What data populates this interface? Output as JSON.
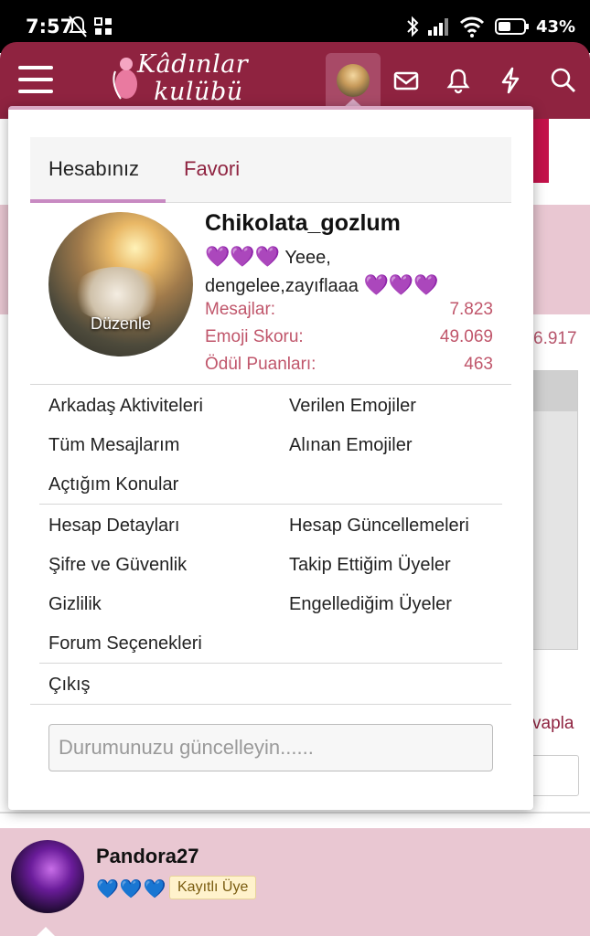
{
  "statusbar": {
    "time": "7:57",
    "battery": "43%"
  },
  "popup": {
    "tabs": [
      {
        "label": "Hesabınız"
      },
      {
        "label": "Favori"
      }
    ],
    "profile": {
      "edit_label": "Düzenle",
      "username": "Chikolata_gozlum",
      "status_hearts": "💜💜💜",
      "status_text": "Yeee, dengelee,zayıflaaa",
      "status_hearts_end": "💜💜💜"
    },
    "stats": [
      {
        "label": "Mesajlar:",
        "value": "7.823"
      },
      {
        "label": "Emoji Skoru:",
        "value": "49.069"
      },
      {
        "label": "Ödül Puanları:",
        "value": "463"
      }
    ],
    "links_group1": {
      "left": [
        "Arkadaş Aktiviteleri",
        "Tüm Mesajlarım",
        "Açtığım Konular"
      ],
      "right": [
        "Verilen Emojiler",
        "Alınan Emojiler"
      ]
    },
    "links_group2": {
      "left": [
        "Hesap Detayları",
        "Şifre ve Güvenlik",
        "Gizlilik",
        "Forum Seçenekleri"
      ],
      "right": [
        "Hesap Güncellemeleri",
        "Takip Ettiğim Üyeler",
        "Engellediğim Üyeler"
      ]
    },
    "logout": "Çıkış",
    "status_placeholder": "Durumunuzu güncelleyin......"
  },
  "background": {
    "count_fragment": "6.917",
    "reply_fragment": "vapla",
    "post": {
      "username": "Pandora27",
      "hearts": "💙💙💙",
      "badge": "Kayıtlı Üye"
    }
  },
  "icons": [
    "menu-icon",
    "avatar-icon",
    "mail-icon",
    "bell-icon",
    "lightning-icon",
    "search-icon"
  ],
  "colors": {
    "brand": "#8f2340",
    "accent": "#c88ac2",
    "stat": "#c0566b"
  }
}
